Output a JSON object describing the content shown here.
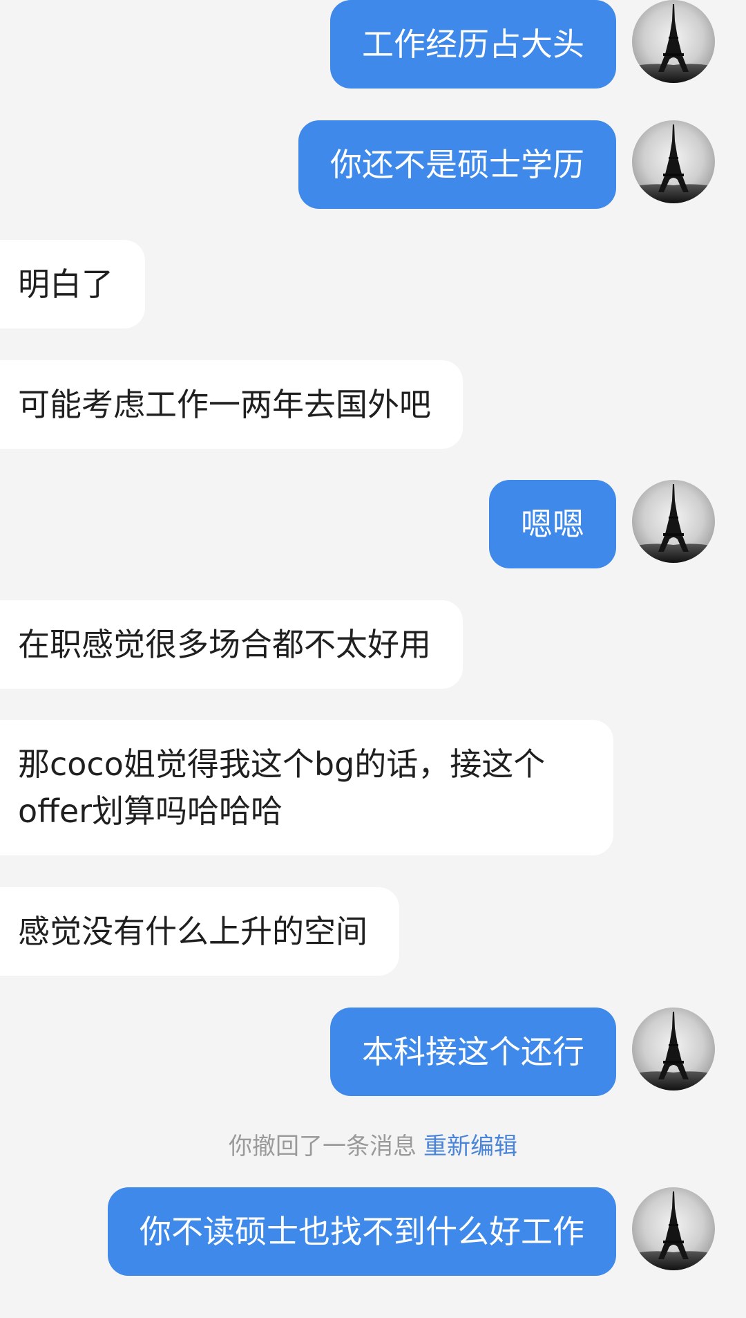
{
  "messages": [
    {
      "side": "outgoing",
      "text": "工作经历占大头"
    },
    {
      "side": "outgoing",
      "text": "你还不是硕士学历"
    },
    {
      "side": "incoming",
      "text": "明白了"
    },
    {
      "side": "incoming",
      "text": "可能考虑工作一两年去国外吧"
    },
    {
      "side": "outgoing",
      "text": "嗯嗯"
    },
    {
      "side": "incoming",
      "text": "在职感觉很多场合都不太好用"
    },
    {
      "side": "incoming",
      "text": "那coco姐觉得我这个bg的话，接这个offer划算吗哈哈哈"
    },
    {
      "side": "incoming",
      "text": "感觉没有什么上升的空间"
    },
    {
      "side": "outgoing",
      "text": "本科接这个还行"
    },
    {
      "side": "outgoing",
      "text": "你不读硕士也找不到什么好工作"
    }
  ],
  "recall_notice": {
    "text": "你撤回了一条消息",
    "action_label": "重新编辑"
  },
  "avatar": {
    "icon": "eiffel-tower-photo-icon"
  },
  "colors": {
    "background": "#f4f4f4",
    "outgoing_bubble": "#3e89ea",
    "incoming_bubble": "#ffffff",
    "link": "#4a84d8"
  }
}
